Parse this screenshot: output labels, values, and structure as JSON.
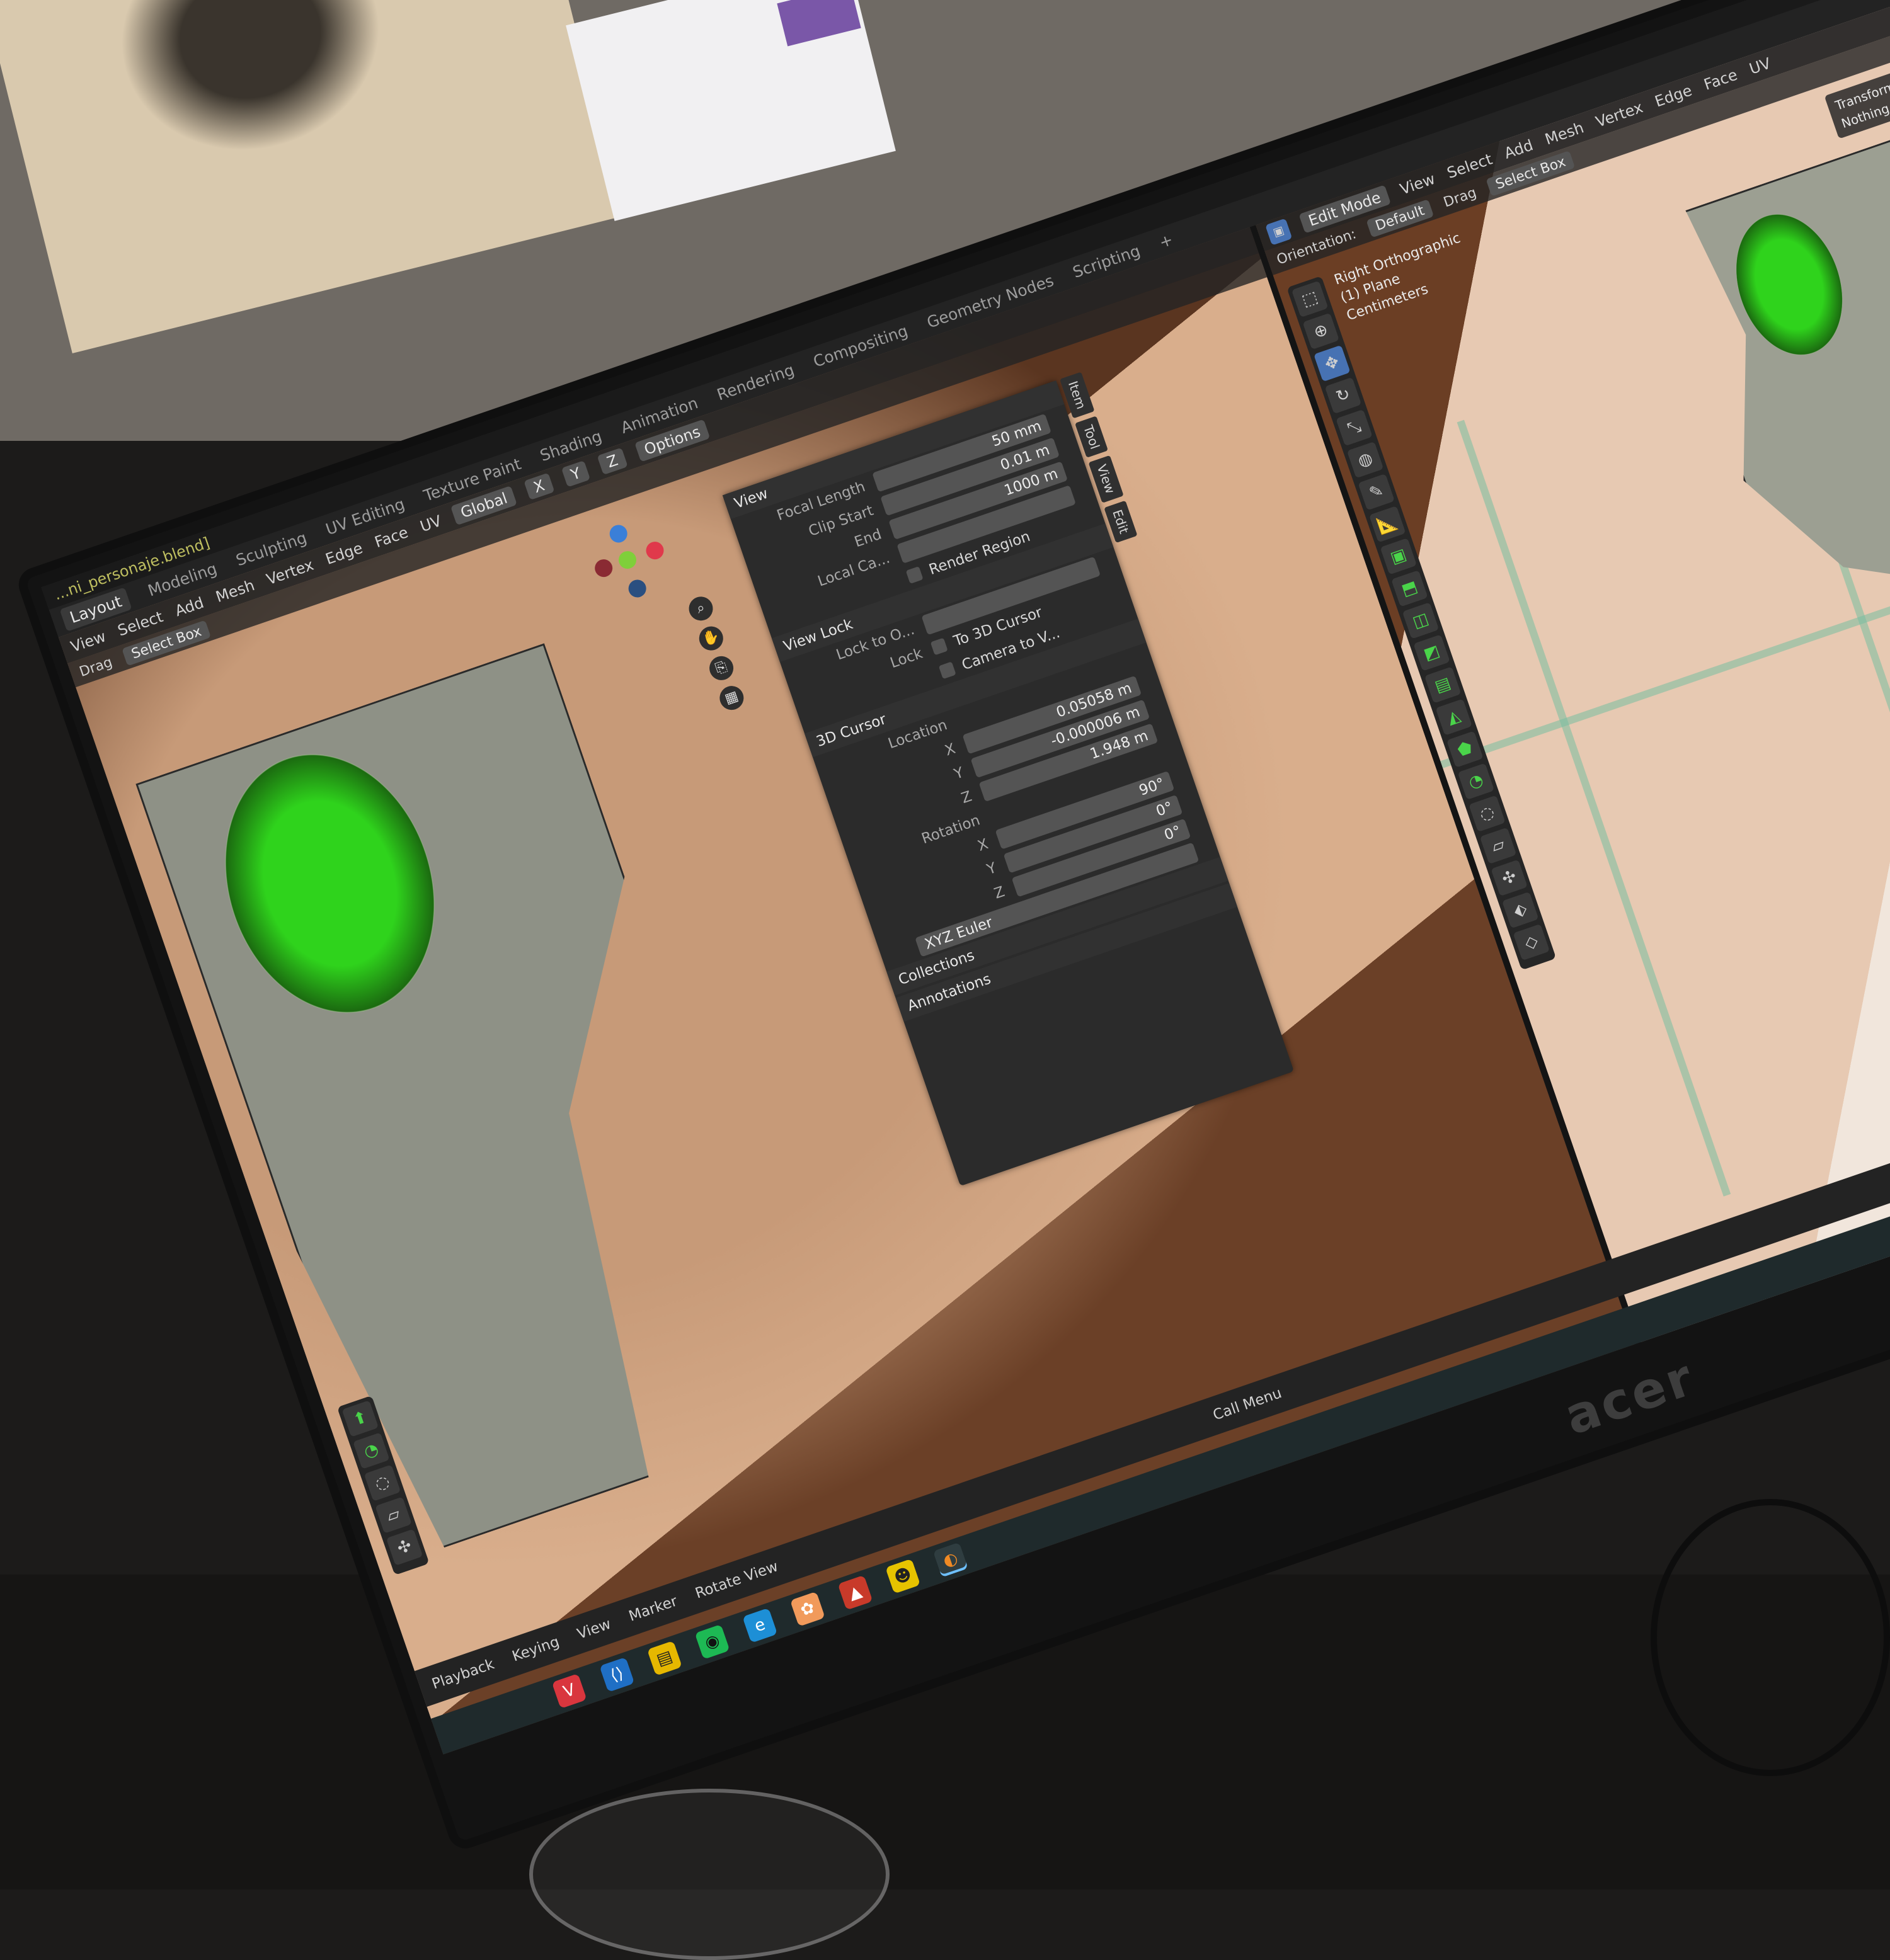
{
  "window": {
    "title": "...ni_personaje.blend]"
  },
  "workspace_tabs": [
    "Layout",
    "Modeling",
    "Sculpting",
    "UV Editing",
    "Texture Paint",
    "Shading",
    "Animation",
    "Rendering",
    "Compositing",
    "Geometry Nodes",
    "Scripting"
  ],
  "left_view": {
    "menu": [
      "View",
      "Select",
      "Add",
      "Mesh",
      "Vertex",
      "Edge",
      "Face",
      "UV"
    ],
    "tool_left": [
      "Drag",
      "Select Box"
    ],
    "orientation": "Global",
    "options_label": "Options",
    "axis_buttons": [
      "X",
      "Y",
      "Z"
    ]
  },
  "right_view": {
    "menu": [
      "View",
      "Select",
      "Add",
      "Mesh",
      "Vertex",
      "Edge",
      "Face",
      "UV"
    ],
    "mode": "Edit Mode",
    "orientation_label": "Orientation:",
    "orientation_value": "Default",
    "tool_left": [
      "Drag",
      "Select Box"
    ],
    "overlay_lines": [
      "Right Orthographic",
      "(1) Plane",
      "Centimeters"
    ],
    "transform_panel": [
      "Transform",
      "Nothing selected"
    ]
  },
  "npanel": {
    "view_header": "View",
    "focal_length_label": "Focal Length",
    "focal_length": "50 mm",
    "clip_start_label": "Clip Start",
    "clip_start": "0.01 m",
    "clip_end_label": "End",
    "clip_end": "1000 m",
    "local_camera_label": "Local Ca...",
    "render_region_label": "Render Region",
    "view_lock_header": "View Lock",
    "lock_to_object_label": "Lock to O...",
    "lock_label": "Lock",
    "to_3d_cursor": "To 3D Cursor",
    "camera_to_view": "Camera to V...",
    "cursor_header": "3D Cursor",
    "location_label": "Location",
    "loc_x": "0.05058 m",
    "loc_y": "-0.000006 m",
    "loc_z": "1.948 m",
    "rotation_label": "Rotation",
    "rot_x": "90°",
    "rot_y": "0°",
    "rot_z": "0°",
    "axis_x": "X",
    "axis_y": "Y",
    "axis_z": "Z",
    "rotation_mode": "XYZ Euler",
    "collections_header": "Collections",
    "annotations_header": "Annotations",
    "tabs": [
      "Item",
      "Tool",
      "View",
      "Edit"
    ]
  },
  "timeline": {
    "menu": [
      "Playback",
      "Keying",
      "View",
      "Marker"
    ],
    "status": "Rotate View",
    "call_menu": "Call Menu",
    "controls": [
      "⏮",
      "◀◀",
      "◀",
      "▶",
      "▶▶",
      "⏭"
    ]
  },
  "taskbar": {
    "icons": [
      "vivaldi-icon",
      "vscode-icon",
      "files-icon",
      "spotify-icon",
      "edge-icon",
      "settings-icon",
      "affinity-icon",
      "discord-icon",
      "blender-icon"
    ]
  },
  "monitor_brand": "acer",
  "colors": {
    "accent_blue": "#4772b3",
    "title_yellow": "#bfbf60",
    "eye_green": "#2fd31c",
    "gizmo_x": "#e0394b",
    "gizmo_y": "#7fcf3a",
    "gizmo_z": "#3a7fd8"
  }
}
